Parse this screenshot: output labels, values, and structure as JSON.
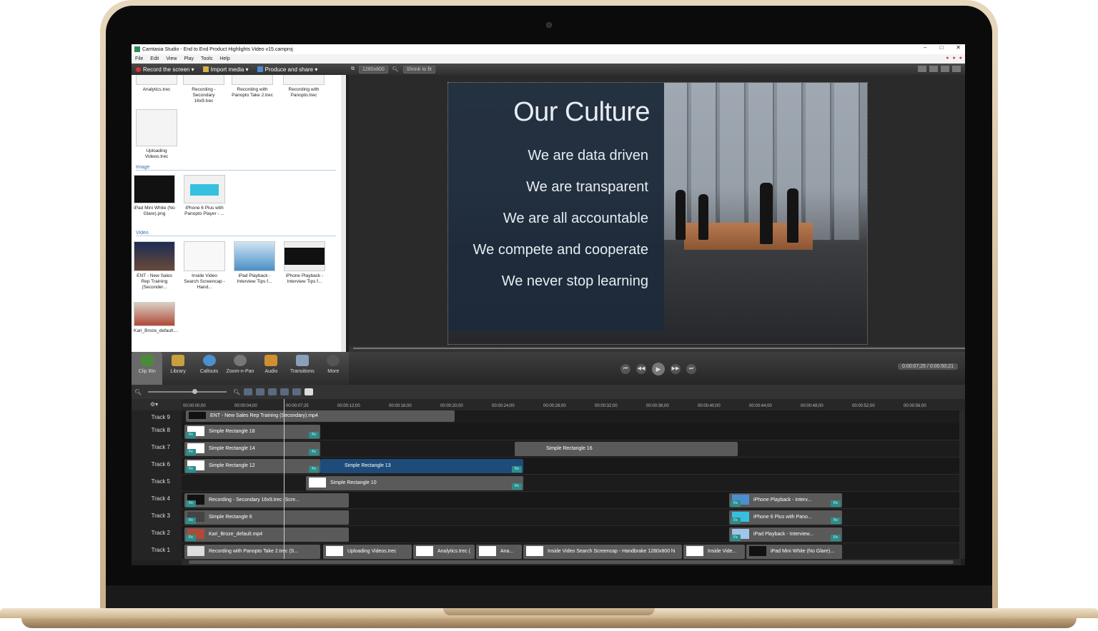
{
  "window": {
    "title": "Camtasia Studio - End to End Product Highlights Video v15.camproj"
  },
  "menu": [
    "File",
    "Edit",
    "View",
    "Play",
    "Tools",
    "Help"
  ],
  "toolbar": {
    "record": "Record the screen ▾",
    "import": "Import media ▾",
    "produce": "Produce and share ▾",
    "dimensions": "1280x800",
    "zoom": "Shrink to fit"
  },
  "clipbin": {
    "items": [
      {
        "label": "Analytics.trec"
      },
      {
        "label": "Recording - Secondary 16x9.trec"
      },
      {
        "label": "Recording with Panopto Take 2.trec"
      },
      {
        "label": "Recording with Panopto.trec"
      },
      {
        "label": "Uploading Videos.trec"
      }
    ],
    "image_section": "Image",
    "images": [
      {
        "label": "iPad Mini White (No Glare).png"
      },
      {
        "label": "iPhone 6 Plus with Panopto Player - ..."
      }
    ],
    "video_section": "Video",
    "videos": [
      {
        "label": "ENT - New Sales Rep Training (Seconder..."
      },
      {
        "label": "Inside Video Search Screencap - Hand..."
      },
      {
        "label": "iPad Playback - Interview Tips f..."
      },
      {
        "label": "iPhone Playback - Interview Tips f..."
      },
      {
        "label": "Kari_Broze_default...."
      }
    ]
  },
  "tasks": [
    "Clip Bin",
    "Library",
    "Callouts",
    "Zoom-n-Pan",
    "Audio",
    "Transitions",
    "More"
  ],
  "slide": {
    "title": "Our Culture",
    "lines": [
      "We are data driven",
      "We are transparent",
      "We are all accountable",
      "We compete and cooperate",
      "We never stop learning"
    ]
  },
  "playback": {
    "timecode": "0:00:07;25 / 0:00:50;21"
  },
  "ruler": [
    "00:00:00;00",
    "00:00:04;00",
    "00:00:07;25",
    "00:00:12;00",
    "00:00:16;00",
    "00:00:20;00",
    "00:00:24;00",
    "00:00:28;00",
    "00:00:32;00",
    "00:00:36;00",
    "00:00:40;00",
    "00:00:44;00",
    "00:00:48;00",
    "00:00:52;00",
    "00:00:56;00"
  ],
  "tracks": [
    {
      "label": "Track 9"
    },
    {
      "label": "Track 8"
    },
    {
      "label": "Track 7"
    },
    {
      "label": "Track 6"
    },
    {
      "label": "Track 5"
    },
    {
      "label": "Track 4"
    },
    {
      "label": "Track 3"
    },
    {
      "label": "Track 2"
    },
    {
      "label": "Track 1"
    }
  ],
  "clips": {
    "t9a": "ENT - New Sales Rep Training (Secondary).mp4",
    "t8a": "Simple Rectangle 18",
    "t7a": "Simple Rectangle 14",
    "t7b": "Simple Rectangle 16",
    "t6a": "Simple Rectangle 12",
    "t6b": "Simple Rectangle 13",
    "t5a": "Simple Rectangle 10",
    "t4a": "Recording - Secondary 16x9.trec (Scre...",
    "t4b": "iPhone Playback - Interv...",
    "t3a": "Simple Rectangle 6",
    "t3b": "iPhone 6 Plus with Pano...",
    "t2a": "Kari_Broze_default.mp4",
    "t2b": "iPad Playback - Interview...",
    "t1a": "Recording with Panopto Take 2.trec (S...",
    "t1b": "Uploading Videos.trec",
    "t1c": "Analytics.trec (",
    "t1d": "Ana...",
    "t1e": "Inside Video Search Screencap - Handbrake 1280x800 hi",
    "t1f": "Inside Vide...",
    "t1g": "iPad Mini White (No Glare)...",
    "fx": "Fx"
  }
}
